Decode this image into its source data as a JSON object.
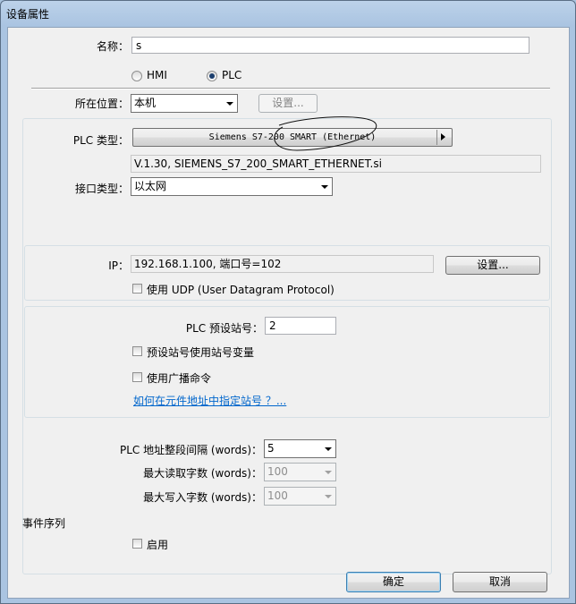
{
  "window": {
    "title": "设备属性"
  },
  "name": {
    "label": "名称：",
    "value": "s"
  },
  "mode": {
    "hmi_label": "HMI",
    "plc_label": "PLC",
    "selected": "PLC"
  },
  "location": {
    "label": "所在位置：",
    "value": "本机",
    "settings_label": "设置..."
  },
  "plc_type": {
    "label": "PLC 类型：",
    "value": "Siemens S7-200 SMART (Ethernet)",
    "driver": "V.1.30, SIEMENS_S7_200_SMART_ETHERNET.si"
  },
  "interface": {
    "label": "接口类型：",
    "value": "以太网"
  },
  "ip": {
    "label": "IP：",
    "value": "192.168.1.100,  端口号=102",
    "settings_label": "设置...",
    "udp_label": "使用 UDP (User Datagram Protocol)"
  },
  "station": {
    "label": "PLC 预设站号：",
    "value": "2",
    "use_variable_label": "预设站号使用站号变量",
    "broadcast_label": "使用广播命令",
    "help_link": "如何在元件地址中指定站号 ？..."
  },
  "address": {
    "interval_label": "PLC 地址整段间隔 (words)：",
    "interval_value": "5",
    "max_read_label": "最大读取字数 (words)：",
    "max_read_value": "100",
    "max_write_label": "最大写入字数 (words)：",
    "max_write_value": "100"
  },
  "event": {
    "section_label": "事件序列",
    "enable_label": "启用"
  },
  "footer": {
    "ok_label": "确定",
    "cancel_label": "取消"
  }
}
